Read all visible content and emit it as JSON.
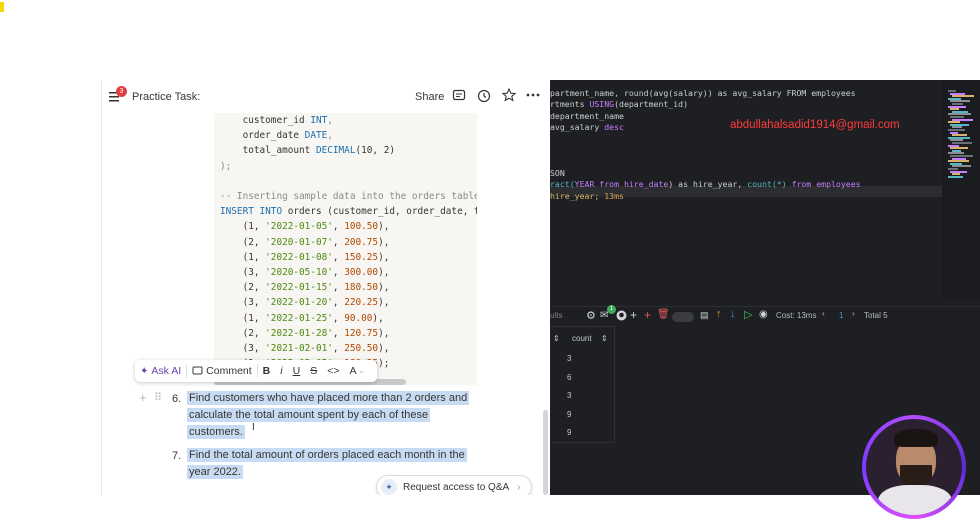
{
  "doc": {
    "notification_count": "3",
    "title": "Practice Task:",
    "share_label": "Share",
    "code_lines": [
      {
        "parts": [
          {
            "t": "    customer_id ",
            "c": ""
          },
          {
            "t": "INT",
            "c": "kw"
          },
          {
            "t": ",",
            "c": "punc"
          }
        ]
      },
      {
        "parts": [
          {
            "t": "    order_date ",
            "c": ""
          },
          {
            "t": "DATE",
            "c": "kw"
          },
          {
            "t": ",",
            "c": "punc"
          }
        ]
      },
      {
        "parts": [
          {
            "t": "    total_amount ",
            "c": ""
          },
          {
            "t": "DECIMAL",
            "c": "kw"
          },
          {
            "t": "(10, 2)",
            "c": ""
          }
        ]
      },
      {
        "parts": [
          {
            "t": ");",
            "c": "punc"
          }
        ]
      },
      {
        "parts": []
      },
      {
        "parts": [
          {
            "t": "-- Inserting sample data into the orders table",
            "c": "cmt"
          }
        ]
      },
      {
        "parts": [
          {
            "t": "INSERT INTO",
            "c": "kw"
          },
          {
            "t": " orders (customer_id, order_date, total_",
            "c": ""
          }
        ]
      },
      {
        "parts": [
          {
            "t": "    (1, ",
            "c": ""
          },
          {
            "t": "'2022-01-05'",
            "c": "str"
          },
          {
            "t": ", ",
            "c": ""
          },
          {
            "t": "100.50",
            "c": "num"
          },
          {
            "t": "),",
            "c": ""
          }
        ]
      },
      {
        "parts": [
          {
            "t": "    (2, ",
            "c": ""
          },
          {
            "t": "'2020-01-07'",
            "c": "str"
          },
          {
            "t": ", ",
            "c": ""
          },
          {
            "t": "200.75",
            "c": "num"
          },
          {
            "t": "),",
            "c": ""
          }
        ]
      },
      {
        "parts": [
          {
            "t": "    (1, ",
            "c": ""
          },
          {
            "t": "'2022-01-08'",
            "c": "str"
          },
          {
            "t": ", ",
            "c": ""
          },
          {
            "t": "150.25",
            "c": "num"
          },
          {
            "t": "),",
            "c": ""
          }
        ]
      },
      {
        "parts": [
          {
            "t": "    (3, ",
            "c": ""
          },
          {
            "t": "'2020-05-10'",
            "c": "str"
          },
          {
            "t": ", ",
            "c": ""
          },
          {
            "t": "300.00",
            "c": "num"
          },
          {
            "t": "),",
            "c": ""
          }
        ]
      },
      {
        "parts": [
          {
            "t": "    (2, ",
            "c": ""
          },
          {
            "t": "'2022-01-15'",
            "c": "str"
          },
          {
            "t": ", ",
            "c": ""
          },
          {
            "t": "180.50",
            "c": "num"
          },
          {
            "t": "),",
            "c": ""
          }
        ]
      },
      {
        "parts": [
          {
            "t": "    (3, ",
            "c": ""
          },
          {
            "t": "'2022-01-20'",
            "c": "str"
          },
          {
            "t": ", ",
            "c": ""
          },
          {
            "t": "220.25",
            "c": "num"
          },
          {
            "t": "),",
            "c": ""
          }
        ]
      },
      {
        "parts": [
          {
            "t": "    (1, ",
            "c": ""
          },
          {
            "t": "'2022-01-25'",
            "c": "str"
          },
          {
            "t": ", ",
            "c": ""
          },
          {
            "t": "90.00",
            "c": "num"
          },
          {
            "t": "),",
            "c": ""
          }
        ]
      },
      {
        "parts": [
          {
            "t": "    (2, ",
            "c": ""
          },
          {
            "t": "'2022-01-28'",
            "c": "str"
          },
          {
            "t": ", ",
            "c": ""
          },
          {
            "t": "120.75",
            "c": "num"
          },
          {
            "t": "),",
            "c": ""
          }
        ]
      },
      {
        "parts": [
          {
            "t": "    (3, ",
            "c": ""
          },
          {
            "t": "'2021-02-01'",
            "c": "str"
          },
          {
            "t": ", ",
            "c": ""
          },
          {
            "t": "250.50",
            "c": "num"
          },
          {
            "t": "),",
            "c": ""
          }
        ]
      },
      {
        "parts": [
          {
            "t": "    (1, ",
            "c": ""
          },
          {
            "t": "'2022-02-05'",
            "c": "str"
          },
          {
            "t": ", ",
            "c": ""
          },
          {
            "t": "180.25",
            "c": "num"
          },
          {
            "t": ");",
            "c": ""
          }
        ]
      }
    ],
    "toolbar": {
      "ask_ai": "Ask AI",
      "comment": "Comment",
      "bold": "B",
      "italic": "i",
      "underline": "U",
      "strike": "S",
      "code": "<>",
      "color": "A"
    },
    "items": [
      {
        "number": "6.",
        "lines": [
          "Find customers who have placed more than 2 orders and",
          "calculate the total amount spent by each of these",
          "customers."
        ]
      },
      {
        "number": "7.",
        "lines": [
          "Find the total amount of orders placed each month in the",
          "year 2022."
        ]
      }
    ],
    "qa_button": "Request access to Q&A"
  },
  "editor": {
    "lines": [
      {
        "parts": [
          {
            "t": "partment_name, round(avg(salary)) as avg_salary FROM employees",
            "c": ""
          }
        ]
      },
      {
        "parts": [
          {
            "t": "rtments ",
            "c": ""
          },
          {
            "t": "USING",
            "c": "dk-kw"
          },
          {
            "t": "(department_id)",
            "c": ""
          }
        ]
      },
      {
        "parts": [
          {
            "t": "department_name",
            "c": ""
          }
        ]
      },
      {
        "parts": [
          {
            "t": "avg_salary ",
            "c": ""
          },
          {
            "t": "desc",
            "c": "dk-kw"
          }
        ]
      },
      {
        "parts": []
      },
      {
        "parts": []
      },
      {
        "parts": []
      },
      {
        "parts": [
          {
            "t": "SON",
            "c": ""
          }
        ]
      },
      {
        "parts": [
          {
            "t": "ract(",
            "c": "dk-fn"
          },
          {
            "t": "YEAR from hire_date",
            "c": "dk-kw"
          },
          {
            "t": ") as hire_year, ",
            "c": ""
          },
          {
            "t": "count(*)",
            "c": "dk-fn"
          },
          {
            "t": " from employees",
            "c": "dk-kw"
          }
        ]
      },
      {
        "parts": [
          {
            "t": "hire_year;",
            "c": "dk-id"
          },
          {
            "t": " 13ms",
            "c": "dk-num"
          }
        ]
      }
    ],
    "email": "abdullahalsadid1914@gmail.com",
    "results_bar": {
      "tab_label": "ults",
      "badge": "1",
      "cost": "Cost: 13ms",
      "page": "1",
      "total": "Total 5"
    },
    "results": {
      "column": "count",
      "values": [
        "3",
        "6",
        "3",
        "9",
        "9"
      ]
    }
  }
}
